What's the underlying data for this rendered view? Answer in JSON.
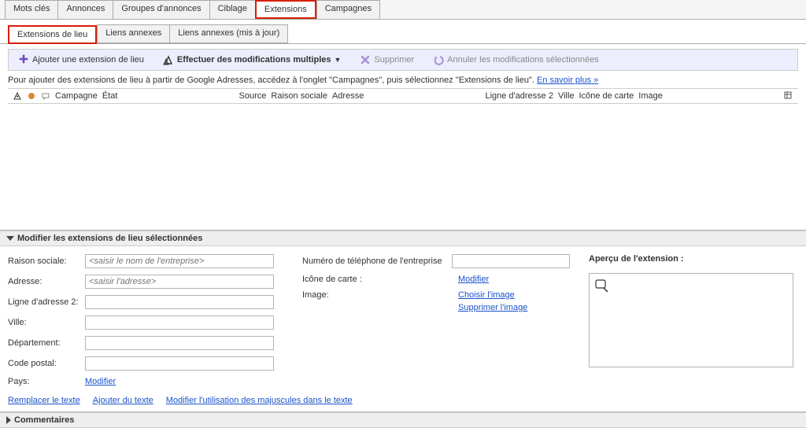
{
  "mainTabs": {
    "motsCles": "Mots clés",
    "annonces": "Annonces",
    "groupes": "Groupes d'annonces",
    "ciblage": "Ciblage",
    "extensions": "Extensions",
    "campagnes": "Campagnes"
  },
  "subTabs": {
    "lieu": "Extensions de lieu",
    "liensAnnexes": "Liens annexes",
    "liensAnnexesMaj": "Liens annexes (mis à jour)"
  },
  "toolbar": {
    "ajouter": "Ajouter une extension de lieu",
    "modifMultiples": "Effectuer des modifications multiples",
    "supprimer": "Supprimer",
    "annuler": "Annuler les modifications sélectionnées"
  },
  "hint": {
    "text": "Pour ajouter des extensions de lieu à partir de Google Adresses, accédez à l'onglet \"Campagnes\", puis sélectionnez \"Extensions de lieu\". ",
    "link": "En savoir plus »"
  },
  "columns": {
    "campagne": "Campagne",
    "etat": "État",
    "source": "Source",
    "raison": "Raison sociale",
    "adresse": "Adresse",
    "ligne2": "Ligne d'adresse 2",
    "ville": "Ville",
    "iconeCarte": "Icône de carte",
    "image": "Image"
  },
  "editPanel": {
    "title": "Modifier les extensions de lieu sélectionnées",
    "labels": {
      "raison": "Raison sociale:",
      "adresse": "Adresse:",
      "ligne2": "Ligne d'adresse 2:",
      "ville": "Ville:",
      "departement": "Département:",
      "codePostal": "Code postal:",
      "pays": "Pays:",
      "phone": "Numéro de téléphone de l'entreprise",
      "iconeCarte": "Icône de carte :",
      "image": "Image:"
    },
    "placeholders": {
      "raison": "<saisir le nom de l'entreprise>",
      "adresse": "<saisir l'adresse>"
    },
    "links": {
      "modifier": "Modifier",
      "choisir": "Choisir l'image",
      "supprimerImg": "Supprimer l'image",
      "remplacer": "Remplacer le texte",
      "ajouterTexte": "Ajouter du texte",
      "modifMaj": "Modifier l'utilisation des majuscules dans le texte"
    },
    "preview": "Aperçu de l'extension :"
  },
  "commentsPanel": {
    "title": "Commentaires"
  }
}
